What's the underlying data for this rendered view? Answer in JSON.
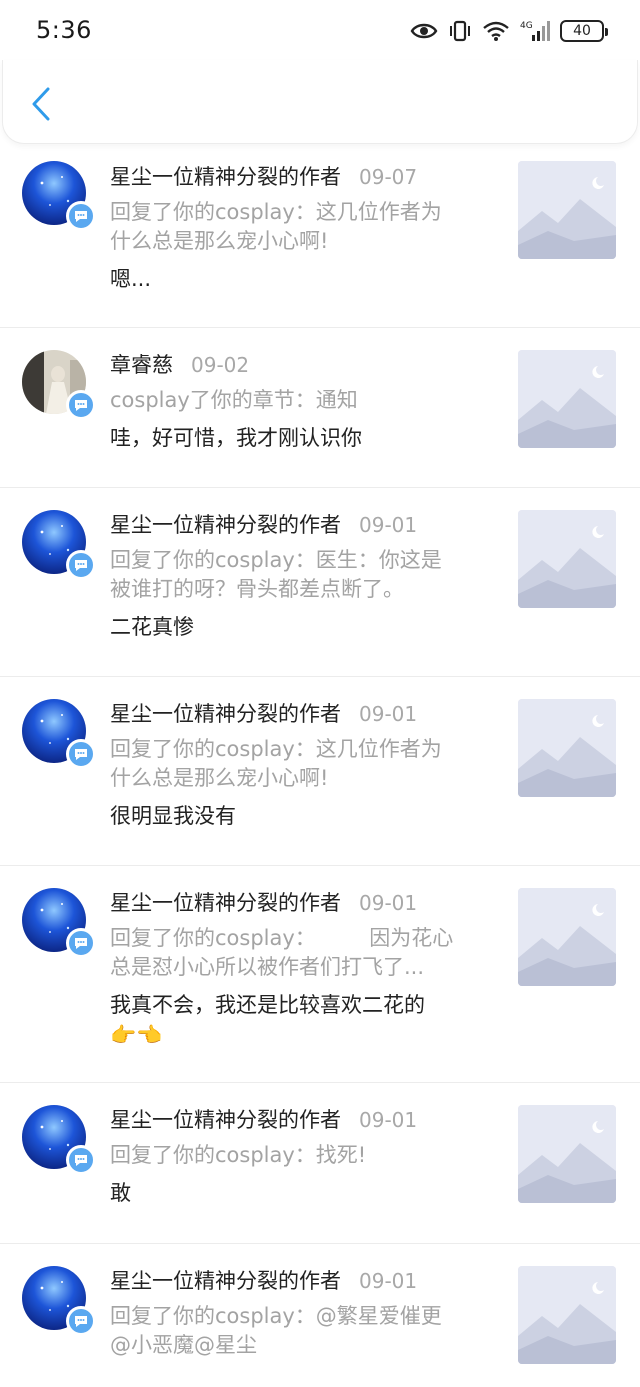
{
  "status": {
    "time": "5:36",
    "battery": "40"
  },
  "header": {
    "back_icon": "chevron-left-icon"
  },
  "notifications": [
    {
      "user": "星尘一位精神分裂的作者",
      "date": "09-07",
      "desc_line1": "回复了你的cosplay：这几位作者为",
      "desc_line2": "什么总是那么宠小心啊!",
      "message": "嗯..."
    },
    {
      "user": "章睿慈",
      "date": "09-02",
      "desc_line1": "cosplay了你的章节：通知",
      "desc_line2": "",
      "message": "哇，好可惜，我才刚认识你"
    },
    {
      "user": "星尘一位精神分裂的作者",
      "date": "09-01",
      "desc_line1": "回复了你的cosplay：医生：你这是",
      "desc_line2": "被谁打的呀？骨头都差点断了。",
      "message": "二花真惨"
    },
    {
      "user": "星尘一位精神分裂的作者",
      "date": "09-01",
      "desc_line1": "回复了你的cosplay：这几位作者为",
      "desc_line2": "什么总是那么宠小心啊!",
      "message": "很明显我没有"
    },
    {
      "user": "星尘一位精神分裂的作者",
      "date": "09-01",
      "desc_line1": "回复了你的cosplay：        因为花心",
      "desc_line2": "总是怼小心所以被作者们打飞了...",
      "message": "我真不会，我还是比较喜欢二花的",
      "emoji": "👉👈"
    },
    {
      "user": "星尘一位精神分裂的作者",
      "date": "09-01",
      "desc_line1": "回复了你的cosplay：找死!",
      "desc_line2": "",
      "message": "敢"
    },
    {
      "user": "星尘一位精神分裂的作者",
      "date": "09-01",
      "desc_line1": "回复了你的cosplay：@繁星爱催更",
      "desc_line2": "@小恶魔@星尘",
      "message": ""
    }
  ],
  "colors": {
    "badge": "#5aa8f0",
    "back_arrow": "#2f9bea",
    "muted_text": "#a3a3a3",
    "divider": "#ececec"
  }
}
